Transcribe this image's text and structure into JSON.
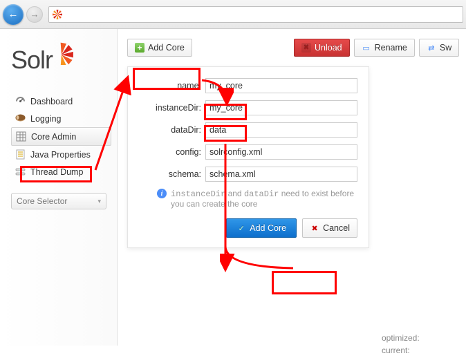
{
  "browser": {
    "back_icon": "←",
    "fwd_icon": "→"
  },
  "logo": {
    "text": "Solr"
  },
  "nav": {
    "dashboard": "Dashboard",
    "logging": "Logging",
    "core_admin": "Core Admin",
    "java_properties": "Java Properties",
    "thread_dump": "Thread Dump"
  },
  "core_selector": {
    "label": "Core Selector",
    "chevron": "▾"
  },
  "toolbar": {
    "add_core": "Add Core",
    "unload": "Unload",
    "rename": "Rename",
    "swap": "Sw"
  },
  "form": {
    "name_label": "name:",
    "name_value": "my_core",
    "instance_label": "instanceDir:",
    "instance_value": "my_core",
    "datadir_label": "dataDir:",
    "datadir_value": "data",
    "config_label": "config:",
    "config_value": "solrconfig.xml",
    "schema_label": "schema:",
    "schema_value": "schema.xml",
    "hint_code1": "instanceDir",
    "hint_and": "and",
    "hint_code2": "dataDir",
    "hint_tail": "need to exist before you can create the core",
    "submit": "Add Core",
    "cancel": "Cancel"
  },
  "status": {
    "optimized": "optimized:",
    "current": "current:"
  }
}
